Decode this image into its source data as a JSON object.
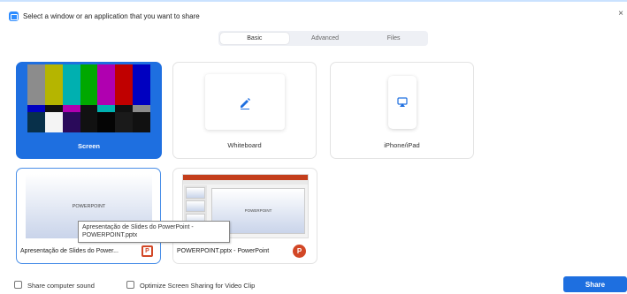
{
  "window": {
    "title": "Select a window or an application that you want to share",
    "close_glyph": "×"
  },
  "tabs": [
    {
      "label": "Basic",
      "active": true
    },
    {
      "label": "Advanced",
      "active": false
    },
    {
      "label": "Files",
      "active": false
    }
  ],
  "tiles": {
    "screen": {
      "label": "Screen",
      "selected": true,
      "icon": "color-bars"
    },
    "whiteboard": {
      "label": "Whiteboard",
      "icon": "pen-icon"
    },
    "iphone": {
      "label": "iPhone/iPad",
      "icon": "airplay-icon"
    }
  },
  "windows": [
    {
      "label": "Apresentação de Slides do Power...",
      "thumb_text": "POWERPOINT",
      "app_icon": "powerpoint-icon",
      "app_glyph": "P"
    },
    {
      "label": "POWERPOINT.pptx - PowerPoint",
      "thumb_text": "POWERPOINT",
      "app_icon": "powerpoint-icon",
      "app_glyph": "P"
    }
  ],
  "tooltip": {
    "line1": "Apresentação de Slides do PowerPoint -",
    "line2": "POWERPOINT.pptx"
  },
  "footer": {
    "share_sound_label": "Share computer sound",
    "optimize_label": "Optimize Screen Sharing for Video Clip",
    "share_button": "Share"
  },
  "colors": {
    "accent": "#1e6fe0",
    "powerpoint": "#d24726"
  }
}
